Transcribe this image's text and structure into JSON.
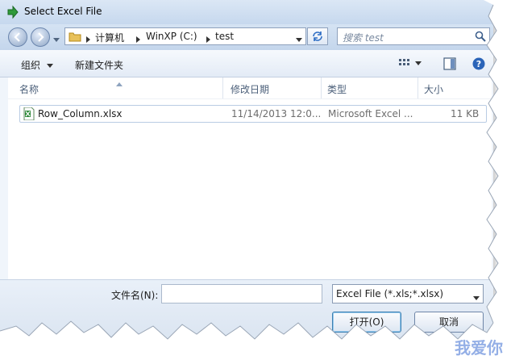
{
  "window": {
    "title": "Select Excel File"
  },
  "breadcrumb": {
    "items": [
      "计算机",
      "WinXP (C:)",
      "test"
    ]
  },
  "search": {
    "placeholder": "搜索 test"
  },
  "toolbar": {
    "organize": "组织",
    "new_folder": "新建文件夹"
  },
  "columns": {
    "name": "名称",
    "modified": "修改日期",
    "type": "类型",
    "size": "大小"
  },
  "files": [
    {
      "name": "Row_Column.xlsx",
      "modified": "11/14/2013 12:0...",
      "type": "Microsoft Excel ...",
      "size": "11 KB"
    }
  ],
  "filename": {
    "label": "文件名(N):",
    "value": ""
  },
  "filter": {
    "selected": "Excel File (*.xls;*.xlsx)"
  },
  "buttons": {
    "open": "打开(O)",
    "cancel": "取消"
  },
  "watermark": "我爱你"
}
